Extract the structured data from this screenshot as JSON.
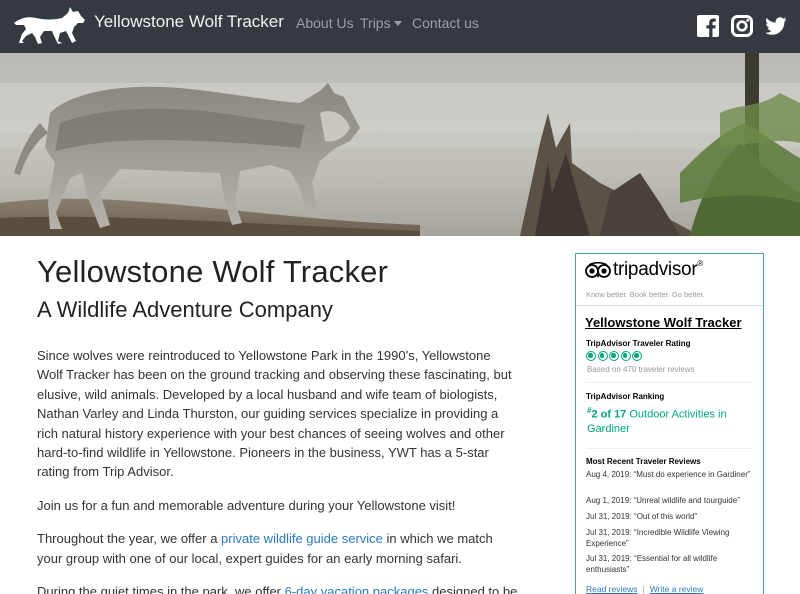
{
  "nav": {
    "brand": "Yellowstone Wolf Tracker",
    "links": [
      {
        "label": "About Us"
      },
      {
        "label": "Trips",
        "dropdown": true
      },
      {
        "label": "Contact us"
      }
    ],
    "social": [
      "facebook-icon",
      "instagram-icon",
      "twitter-icon"
    ]
  },
  "main": {
    "title": "Yellowstone Wolf Tracker",
    "subtitle": "A Wildlife Adventure Company",
    "p1": "Since wolves were reintroduced to Yellowstone Park in the 1990’s, Yellowstone Wolf Tracker has been on the ground tracking and observing these fascinating, but elusive, wild animals. Developed by a local husband and wife team of biologists, Nathan Varley and Linda Thurston, our guiding services specialize in providing a rich natural history experience with your best chances of seeing wolves and other hard-to-find wildlife in Yellowstone. Pioneers in the business, YWT has a 5-star rating from Trip Advisor.",
    "p2": "Join us for a fun and memorable adventure during your Yellowstone visit!",
    "p3_before": "Throughout the year, we offer a ",
    "p3_link": "private wildlife guide service",
    "p3_after": " in which we match your group with one of our local, expert guides for an early morning safari.",
    "p4_before": "During the quiet times in the park, we offer ",
    "p4_link": "6-day vacation packages",
    "p4_after": " designed to be"
  },
  "tripadvisor": {
    "logo": "tripadvisor",
    "tagline": "Know better. Book better. Go better.",
    "business_name": "Yellowstone Wolf Tracker",
    "rating_label": "TripAdvisor Traveler Rating",
    "rating_bubbles": 5,
    "based_on": "Based on 470 traveler reviews",
    "ranking_label": "TripAdvisor Ranking",
    "ranking_hash": "#",
    "ranking_num": "2 of 17",
    "ranking_text": " Outdoor Activities in Gardiner",
    "reviews_label": "Most Recent Traveler Reviews",
    "reviews": [
      {
        "text": "Aug 4, 2019: “Must do experience in Gardiner”"
      },
      {
        "text": "Aug 1, 2019: “Unreal wildlife and tourguide”"
      },
      {
        "text": "Jul 31, 2019: “Out of this world”"
      },
      {
        "text": "Jul 31, 2019: “Incredible Wildlife Viewing Experience”"
      },
      {
        "text": "Jul 31, 2019: “Essential for all wildlife enthusiasts”"
      }
    ],
    "read_reviews": "Read reviews",
    "write_review": "Write a review"
  },
  "colors": {
    "navbar_bg": "#343a40",
    "link": "#2a7ac0",
    "ta_green": "#00a680",
    "widget_border": "#4aa58f"
  }
}
